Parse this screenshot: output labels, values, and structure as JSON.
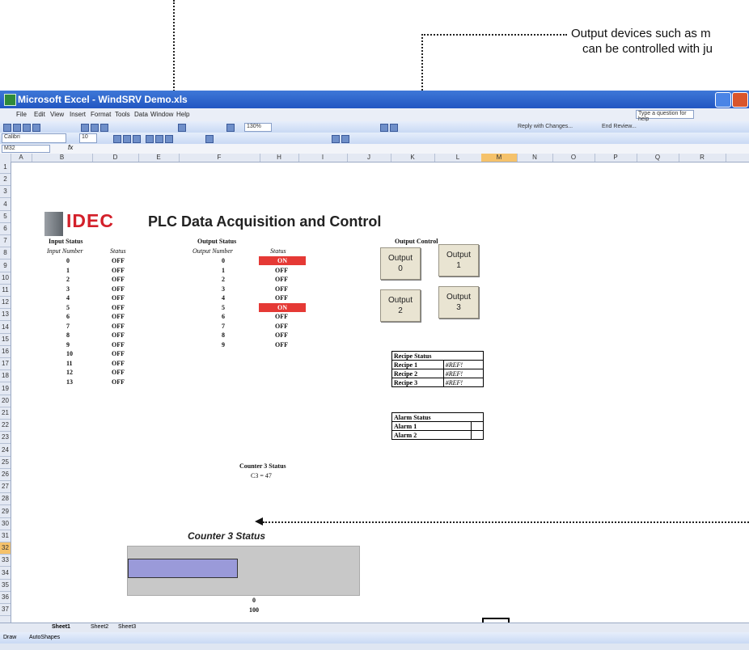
{
  "callouts": {
    "output_devices_line1": "Output devices such as m",
    "output_devices_line2": "can be controlled with ju"
  },
  "window": {
    "title": "Microsoft Excel - WindSRV Demo.xls",
    "help_placeholder": "Type a question for help",
    "font_name": "Calibri",
    "font_size": "10",
    "zoom": "130%",
    "name_box": "M32",
    "reply_label": "Reply with Changes...",
    "end_review_label": "End Review..."
  },
  "menu": [
    "File",
    "Edit",
    "View",
    "Insert",
    "Format",
    "Tools",
    "Data",
    "Window",
    "Help"
  ],
  "columns": [
    "A",
    "B",
    "D",
    "E",
    "F",
    "H",
    "I",
    "J",
    "K",
    "L",
    "M",
    "N",
    "O",
    "P",
    "Q",
    "R"
  ],
  "selected_column": "M",
  "selected_row": "32",
  "rows": [
    "1",
    "2",
    "3",
    "4",
    "5",
    "6",
    "7",
    "8",
    "9",
    "10",
    "11",
    "12",
    "13",
    "14",
    "15",
    "16",
    "17",
    "18",
    "19",
    "20",
    "21",
    "22",
    "23",
    "24",
    "25",
    "26",
    "27",
    "28",
    "29",
    "30",
    "31",
    "32",
    "33",
    "34",
    "35",
    "36",
    "37"
  ],
  "sheet": {
    "logo": "IDEC",
    "title": "PLC Data Acquisition and Control",
    "input": {
      "header": "Input Status",
      "number_label": "Input Number",
      "status_label": "Status",
      "numbers": [
        "0",
        "1",
        "2",
        "3",
        "4",
        "5",
        "6",
        "7",
        "8",
        "9",
        "10",
        "11",
        "12",
        "13"
      ],
      "statuses": [
        "OFF",
        "OFF",
        "OFF",
        "OFF",
        "OFF",
        "OFF",
        "OFF",
        "OFF",
        "OFF",
        "OFF",
        "OFF",
        "OFF",
        "OFF",
        "OFF"
      ]
    },
    "output": {
      "header": "Output Status",
      "number_label": "Output Number",
      "status_label": "Status",
      "numbers": [
        "0",
        "1",
        "2",
        "3",
        "4",
        "5",
        "6",
        "7",
        "8",
        "9"
      ],
      "statuses": [
        "ON",
        "OFF",
        "OFF",
        "OFF",
        "OFF",
        "ON",
        "OFF",
        "OFF",
        "OFF",
        "OFF"
      ],
      "on_color": "#e53935"
    },
    "counter": {
      "header": "Counter 3 Status",
      "value_text": "C3 = 47"
    },
    "output_control": {
      "header": "Output Control",
      "buttons": [
        {
          "line1": "Output",
          "line2": "0"
        },
        {
          "line1": "Output",
          "line2": "1"
        },
        {
          "line1": "Output",
          "line2": "2"
        },
        {
          "line1": "Output",
          "line2": "3"
        }
      ]
    },
    "recipe": {
      "header": "Recipe Status",
      "rows": [
        {
          "name": "Recipe 1",
          "value": "#REF!"
        },
        {
          "name": "Recipe 2",
          "value": "#REF!"
        },
        {
          "name": "Recipe 3",
          "value": "#REF!"
        }
      ]
    },
    "alarm": {
      "header": "Alarm Status",
      "rows": [
        {
          "name": "Alarm 1",
          "value": ""
        },
        {
          "name": "Alarm 2",
          "value": ""
        }
      ]
    },
    "chart": {
      "title": "Counter 3 Status",
      "min_label": "0",
      "max_label": "100",
      "fill_fraction": 0.47,
      "bar_color": "#9a9ad9"
    }
  },
  "sheet_tabs": [
    "Sheet1",
    "Sheet2",
    "Sheet3"
  ],
  "draw_toolbar": {
    "draw": "Draw",
    "autoshapes": "AutoShapes"
  }
}
